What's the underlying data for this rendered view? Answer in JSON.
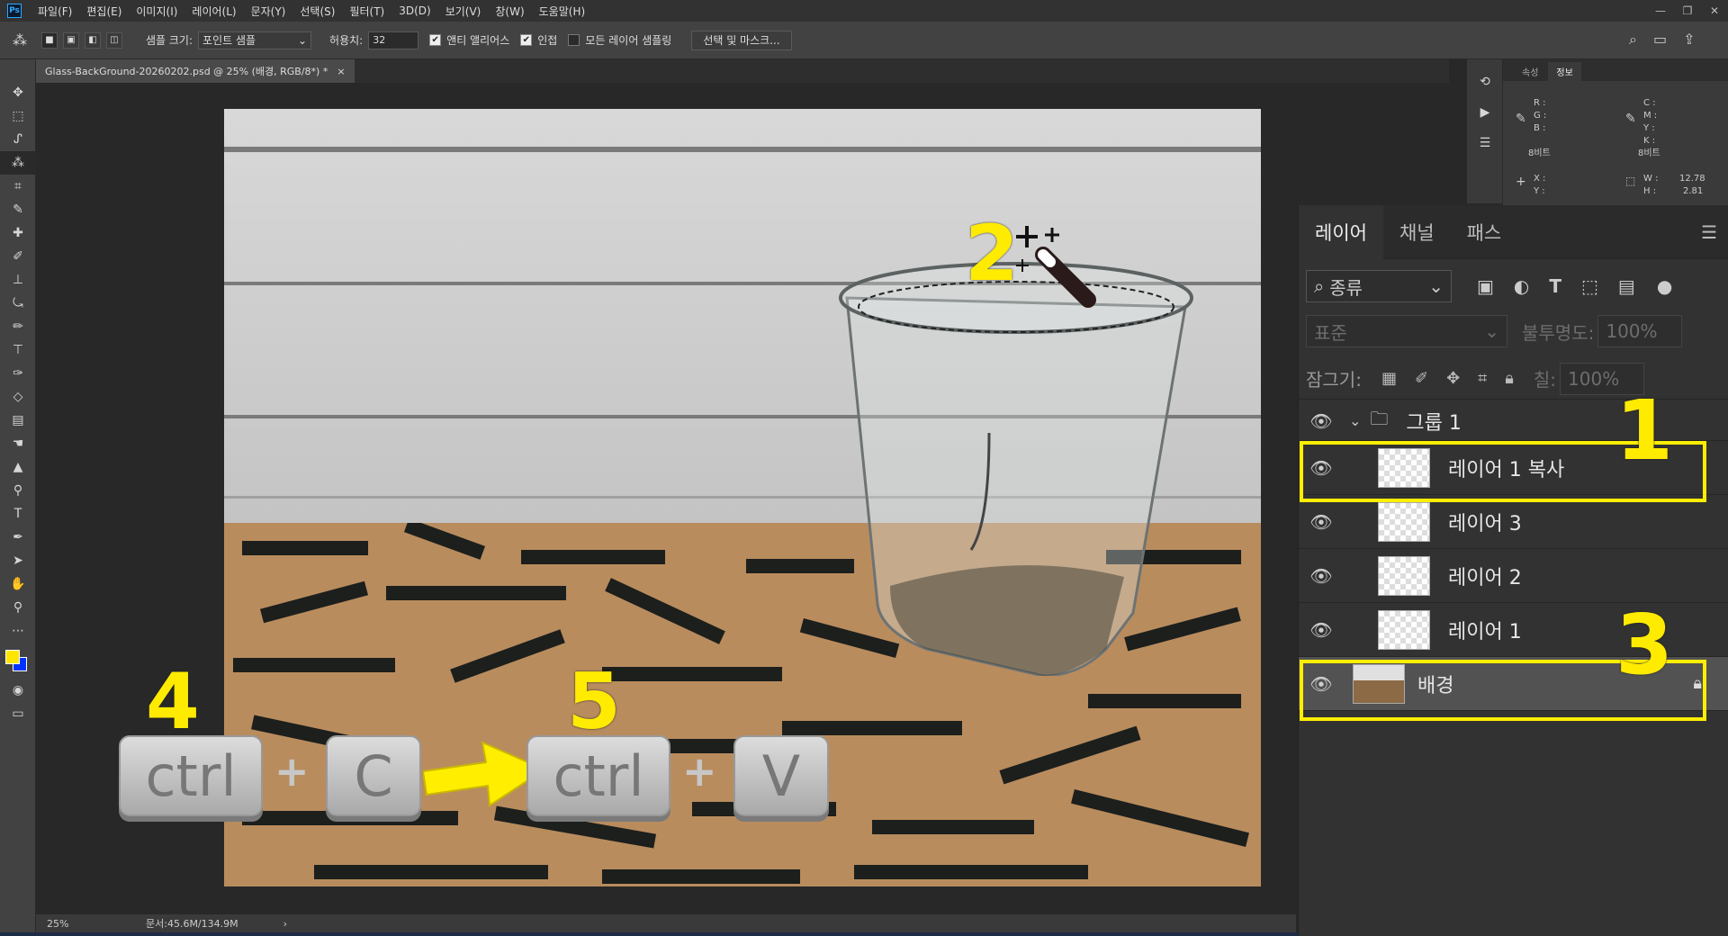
{
  "app": {
    "logo": "Ps"
  },
  "menu": [
    "파일(F)",
    "편집(E)",
    "이미지(I)",
    "레이어(L)",
    "문자(Y)",
    "선택(S)",
    "필터(T)",
    "3D(D)",
    "보기(V)",
    "창(W)",
    "도움말(H)"
  ],
  "window_controls": [
    "—",
    "❐",
    "✕"
  ],
  "options": {
    "sample_size_label": "샘플 크기:",
    "sample_size_value": "포인트 샘플",
    "tolerance_label": "허용치:",
    "tolerance_value": "32",
    "anti_alias_label": "앤티 앨리어스",
    "anti_alias_checked": true,
    "contiguous_label": "인접",
    "contiguous_checked": true,
    "all_layers_label": "모든 레이어 샘플링",
    "all_layers_checked": false,
    "select_mask_button": "선택 및 마스크..."
  },
  "document": {
    "tab_title": "Glass-BackGround-20260202.psd @ 25% (배경, RGB/8*) *",
    "tab_close": "×"
  },
  "status": {
    "zoom": "25%",
    "doc_size": "문서:45.6M/134.9M",
    "arrow": "›"
  },
  "info_panel": {
    "tabs": [
      "속성",
      "정보"
    ],
    "active_tab": "정보",
    "rgb": "R :\nG :\nB :",
    "cmyk": "C :\nM :\nY :\nK :",
    "bit_left": "8비트",
    "bit_right": "8비트",
    "xy": "X :\nY :",
    "wh": "W :\nH :",
    "w_value": "12.78",
    "h_value": "2.81"
  },
  "layers_panel": {
    "tabs": [
      "레이어",
      "채널",
      "패스"
    ],
    "active_tab": "레이어",
    "kind_filter": "종류",
    "blend_mode": "표준",
    "opacity_label": "불투명도:",
    "opacity_value": "100%",
    "lock_label": "잠그기:",
    "fill_label": "칠:",
    "fill_value": "100%",
    "group_name": "그룹 1",
    "layers": [
      {
        "name": "레이어 1 복사",
        "selected": false
      },
      {
        "name": "레이어 3",
        "selected": false
      },
      {
        "name": "레이어 2",
        "selected": false
      },
      {
        "name": "레이어 1",
        "selected": false
      },
      {
        "name": "배경",
        "selected": true,
        "locked": true
      }
    ]
  },
  "annotations": {
    "step1": "1",
    "step2": "2",
    "step3": "3",
    "step4": "4",
    "step5": "5",
    "key_ctrl_1": "ctrl",
    "key_c": "C",
    "key_ctrl_2": "ctrl",
    "key_v": "V",
    "plus": "+",
    "highlight_color": "#ffee00"
  },
  "colors": {
    "foreground": "#ffe600",
    "background": "#0033ff",
    "accent": "#31a8ff"
  }
}
